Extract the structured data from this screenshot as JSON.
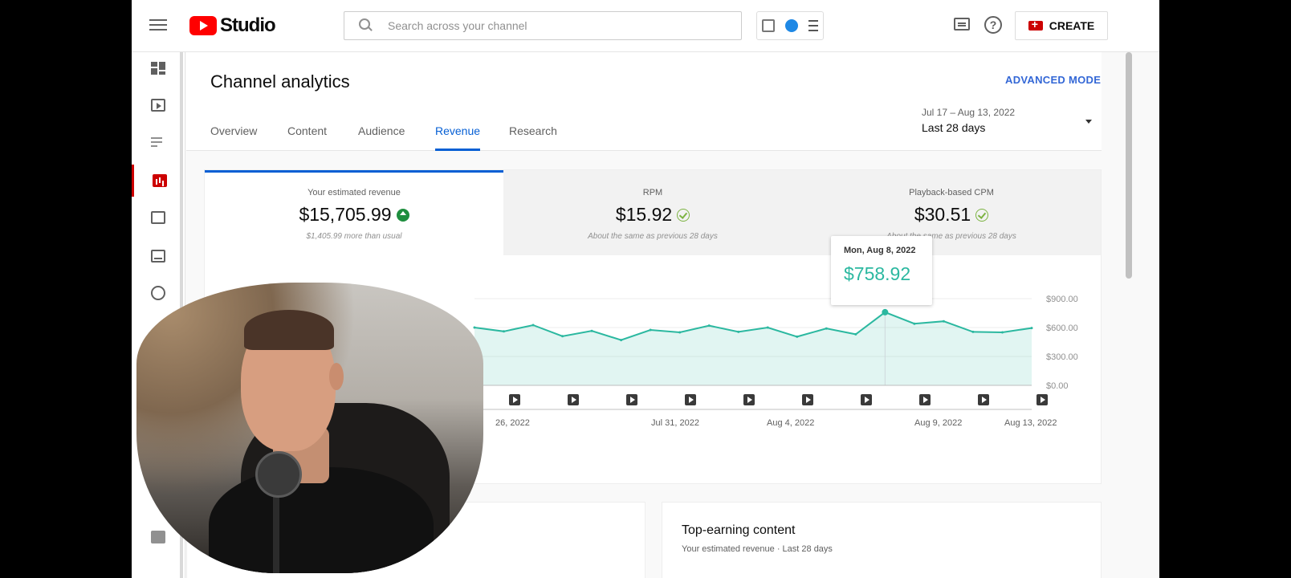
{
  "app": {
    "logo_text": "Studio"
  },
  "search": {
    "placeholder": "Search across your channel"
  },
  "header": {
    "create_label": "CREATE"
  },
  "page": {
    "title": "Channel analytics",
    "advanced_mode": "ADVANCED MODE",
    "tabs": [
      {
        "label": "Overview",
        "active": false
      },
      {
        "label": "Content",
        "active": false
      },
      {
        "label": "Audience",
        "active": false
      },
      {
        "label": "Revenue",
        "active": true
      },
      {
        "label": "Research",
        "active": false
      }
    ],
    "date_range": {
      "dates": "Jul 17 – Aug 13, 2022",
      "label": "Last 28 days"
    }
  },
  "metrics": [
    {
      "label": "Your estimated revenue",
      "value": "$15,705.99",
      "sub": "$1,405.99 more than usual",
      "status_icon": "up-arrow-icon",
      "active": true
    },
    {
      "label": "RPM",
      "value": "$15.92",
      "sub": "About the same as previous 28 days",
      "status_icon": "check-icon",
      "active": false
    },
    {
      "label": "Playback-based CPM",
      "value": "$30.51",
      "sub": "About the same as previous 28 days",
      "status_icon": "check-icon",
      "active": false
    }
  ],
  "tooltip": {
    "date": "Mon, Aug 8, 2022",
    "value": "$758.92"
  },
  "chart_data": {
    "type": "area",
    "title": "",
    "xlabel": "",
    "ylabel": "",
    "x_tick_labels": [
      "26, 2022",
      "Jul 31, 2022",
      "Aug 4, 2022",
      "Aug 9, 2022",
      "Aug 13, 2022"
    ],
    "y_tick_labels": [
      "$900.00",
      "$600.00",
      "$300.00",
      "$0.00"
    ],
    "ylim": [
      0,
      900
    ],
    "grid": true,
    "color": "#2bb8a0",
    "visible_points": [
      {
        "x": 0,
        "y": 600
      },
      {
        "x": 1,
        "y": 560
      },
      {
        "x": 2,
        "y": 625
      },
      {
        "x": 3,
        "y": 510
      },
      {
        "x": 4,
        "y": 565
      },
      {
        "x": 5,
        "y": 470
      },
      {
        "x": 6,
        "y": 575
      },
      {
        "x": 7,
        "y": 550
      },
      {
        "x": 8,
        "y": 620
      },
      {
        "x": 9,
        "y": 555
      },
      {
        "x": 10,
        "y": 600
      },
      {
        "x": 11,
        "y": 505
      },
      {
        "x": 12,
        "y": 590
      },
      {
        "x": 13,
        "y": 530
      },
      {
        "x": 14,
        "y": 758.92
      },
      {
        "x": 15,
        "y": 640
      },
      {
        "x": 16,
        "y": 665
      },
      {
        "x": 17,
        "y": 555
      },
      {
        "x": 18,
        "y": 550
      },
      {
        "x": 19,
        "y": 595
      }
    ],
    "highlighted_point": {
      "x": 14,
      "y": 758.92
    }
  },
  "top_earning": {
    "title": "Top-earning content",
    "subtitle": "Your estimated revenue · Last 28 days"
  }
}
